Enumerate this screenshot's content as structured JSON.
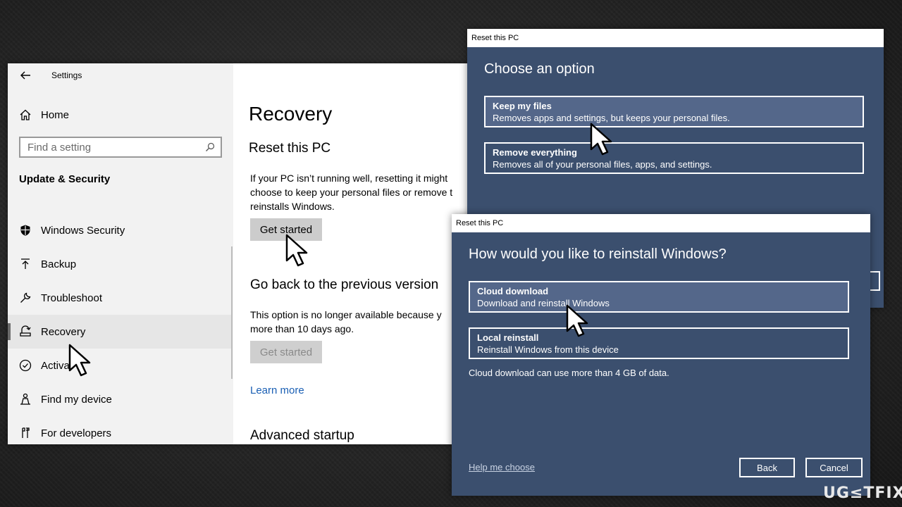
{
  "settings": {
    "title": "Settings",
    "home_label": "Home",
    "search_placeholder": "Find a setting",
    "section_title": "Update & Security",
    "nav_items": [
      {
        "label": "Windows Security",
        "icon": "shield-icon"
      },
      {
        "label": "Backup",
        "icon": "backup-arrow-icon"
      },
      {
        "label": "Troubleshoot",
        "icon": "wrench-icon"
      },
      {
        "label": "Recovery",
        "icon": "recovery-icon",
        "active": true
      },
      {
        "label": "Activa",
        "icon": "check-circle-icon"
      },
      {
        "label": "Find my device",
        "icon": "person-locate-icon"
      },
      {
        "label": "For developers",
        "icon": "developer-tools-icon"
      }
    ],
    "content": {
      "page_title": "Recovery",
      "reset_title": "Reset this PC",
      "reset_desc": [
        "If your PC isn’t running well, resetting it might",
        "choose to keep your personal files or remove t",
        "reinstalls Windows."
      ],
      "reset_button": "Get started",
      "goback_title": "Go back to the previous version",
      "goback_desc": [
        "This option is no longer available because y",
        "more than 10 days ago."
      ],
      "goback_button": "Get started",
      "learn_more": "Learn more",
      "advanced_title": "Advanced startup"
    }
  },
  "dialog1": {
    "window_title": "Reset this PC",
    "heading": "Choose an option",
    "options": [
      {
        "title": "Keep my files",
        "desc": "Removes apps and settings, but keeps your personal files."
      },
      {
        "title": "Remove everything",
        "desc": "Removes all of your personal files, apps, and settings."
      }
    ]
  },
  "dialog2": {
    "window_title": "Reset this PC",
    "heading": "How would you like to reinstall Windows?",
    "options": [
      {
        "title": "Cloud download",
        "desc": "Download and reinstall Windows"
      },
      {
        "title": "Local reinstall",
        "desc": "Reinstall Windows from this device"
      }
    ],
    "note": "Cloud download can use more than 4 GB of data.",
    "help_link": "Help me choose",
    "back_button": "Back",
    "cancel_button": "Cancel"
  },
  "watermark": "UG≤TFIX",
  "colors": {
    "dialog_bg": "#3b4f6e",
    "selected_option": "#54678a",
    "settings_sidebar": "#f2f2f2",
    "button_gray": "#cccccc"
  }
}
